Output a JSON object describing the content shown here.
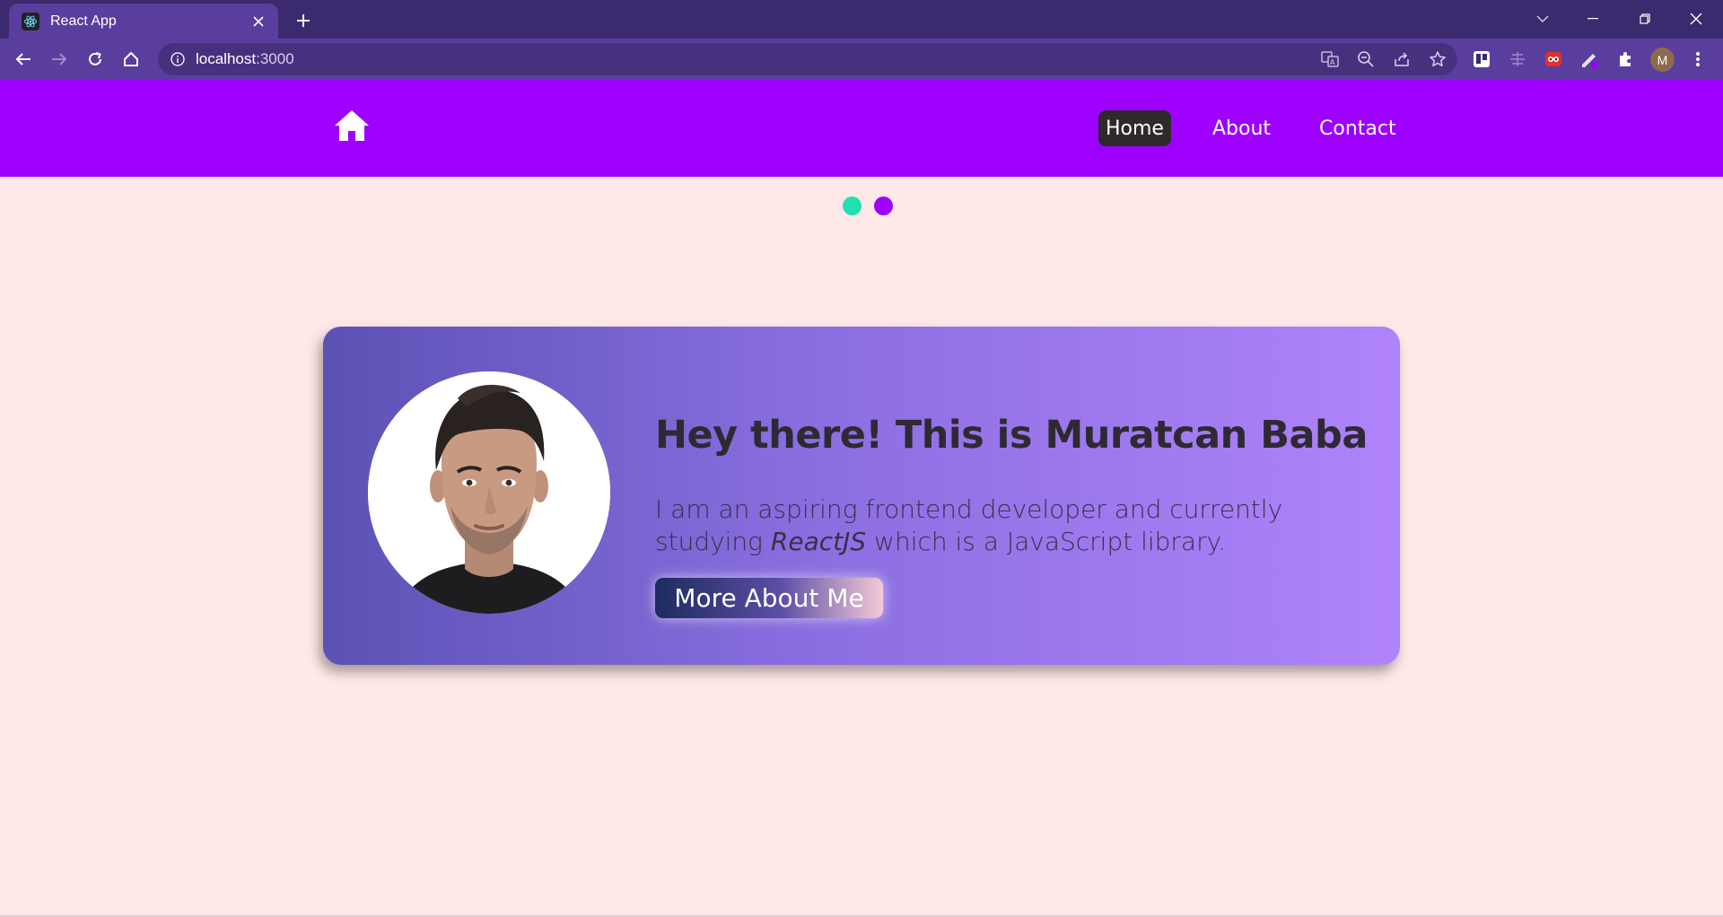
{
  "browser": {
    "tab_title": "React App",
    "url_host": "localhost",
    "url_port": ":3000",
    "profile_initial": "M"
  },
  "navbar": {
    "links": [
      {
        "label": "Home",
        "active": true
      },
      {
        "label": "About",
        "active": false
      },
      {
        "label": "Contact",
        "active": false
      }
    ]
  },
  "hero": {
    "headline": "Hey there! This is Muratcan Baba",
    "desc_before": "I am an aspiring frontend developer and currently studying ",
    "desc_em": "ReactJS",
    "desc_after": " which is a JavaScript library.",
    "cta_label": "More About Me"
  },
  "colors": {
    "nav_bg": "#9d00ff",
    "page_bg": "#ffe9e8",
    "dot_1": "#1fe0b0",
    "dot_2": "#9d00ff"
  }
}
